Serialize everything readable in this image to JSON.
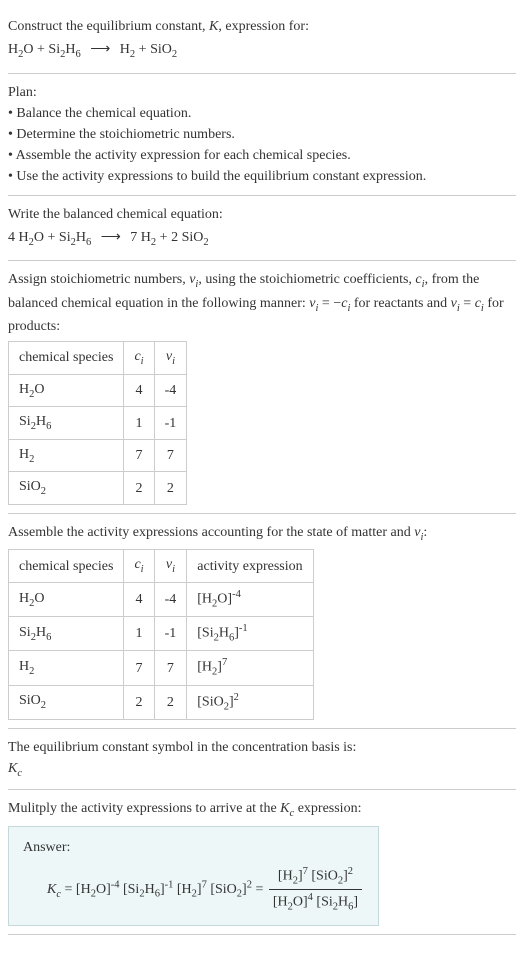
{
  "prompt": {
    "line1_pre": "Construct the equilibrium constant, ",
    "line1_K": "K",
    "line1_post": ", expression for:",
    "eq_lhs_h2o": "H",
    "eq_lhs_plus": " + ",
    "eq_lhs_sih": "Si",
    "eq_lhs_sih_sub1": "2",
    "eq_lhs_sih_h": "H",
    "eq_lhs_sih_sub2": "6",
    "eq_arrow": "⟶",
    "eq_rhs_h2": "H",
    "eq_rhs_h2_sub": "2",
    "eq_rhs_plus": " + ",
    "eq_rhs_sio": "SiO",
    "eq_rhs_sio_sub": "2",
    "h2o_sub": "2"
  },
  "plan": {
    "title": "Plan:",
    "b1": "• Balance the chemical equation.",
    "b2": "• Determine the stoichiometric numbers.",
    "b3": "• Assemble the activity expression for each chemical species.",
    "b4": "• Use the activity expressions to build the equilibrium constant expression."
  },
  "balanced": {
    "title": "Write the balanced chemical equation:",
    "c_h2o": "4 H",
    "h2o_sub": "2",
    "h2o_o": "O",
    "plus1": " + ",
    "sih": "Si",
    "sih_sub1": "2",
    "sih_h": "H",
    "sih_sub2": "6",
    "arrow": "⟶",
    "c_h2": "7 H",
    "h2_sub": "2",
    "plus2": " + ",
    "c_sio": "2 SiO",
    "sio_sub": "2"
  },
  "stoich": {
    "intro1": "Assign stoichiometric numbers, ",
    "nu": "ν",
    "i": "i",
    "intro2": ", using the stoichiometric coefficients, ",
    "c": "c",
    "intro3": ", from the balanced chemical equation in the following manner: ",
    "rel_react_lhs": "ν",
    "rel_react_eq": " = −",
    "rel_react_rhs": "c",
    "for_react": " for reactants and ",
    "rel_prod_lhs": "ν",
    "rel_prod_eq": " = ",
    "rel_prod_rhs": "c",
    "for_prod": " for products:",
    "th_species": "chemical species",
    "th_ci": "c",
    "th_nui": "ν",
    "rows": [
      {
        "species_a": "H",
        "sub_a": "2",
        "species_b": "O",
        "sub_b": "",
        "ci": "4",
        "nui": "-4"
      },
      {
        "species_a": "Si",
        "sub_a": "2",
        "species_b": "H",
        "sub_b": "6",
        "ci": "1",
        "nui": "-1"
      },
      {
        "species_a": "H",
        "sub_a": "2",
        "species_b": "",
        "sub_b": "",
        "ci": "7",
        "nui": "7"
      },
      {
        "species_a": "SiO",
        "sub_a": "2",
        "species_b": "",
        "sub_b": "",
        "ci": "2",
        "nui": "2"
      }
    ]
  },
  "activity": {
    "intro_pre": "Assemble the activity expressions accounting for the state of matter and ",
    "nu": "ν",
    "i": "i",
    "intro_post": ":",
    "th_species": "chemical species",
    "th_ci": "c",
    "th_nui": "ν",
    "th_act": "activity expression",
    "rows": [
      {
        "sp_a": "H",
        "sub_a": "2",
        "sp_b": "O",
        "sub_b": "",
        "ci": "4",
        "nui": "-4",
        "act_a": "[H",
        "act_sub": "2",
        "act_b": "O]",
        "exp": "-4"
      },
      {
        "sp_a": "Si",
        "sub_a": "2",
        "sp_b": "H",
        "sub_b": "6",
        "ci": "1",
        "nui": "-1",
        "act_a": "[Si",
        "act_sub": "2",
        "act_b2": "H",
        "act_sub2": "6",
        "act_b": "]",
        "exp": "-1"
      },
      {
        "sp_a": "H",
        "sub_a": "2",
        "sp_b": "",
        "sub_b": "",
        "ci": "7",
        "nui": "7",
        "act_a": "[H",
        "act_sub": "2",
        "act_b": "]",
        "exp": "7"
      },
      {
        "sp_a": "SiO",
        "sub_a": "2",
        "sp_b": "",
        "sub_b": "",
        "ci": "2",
        "nui": "2",
        "act_a": "[SiO",
        "act_sub": "2",
        "act_b": "]",
        "exp": "2"
      }
    ]
  },
  "symbol": {
    "text": "The equilibrium constant symbol in the concentration basis is:",
    "K": "K",
    "c": "c"
  },
  "multiply": {
    "pre": "Mulitply the activity expressions to arrive at the ",
    "K": "K",
    "c": "c",
    "post": " expression:"
  },
  "answer": {
    "label": "Answer:",
    "K": "K",
    "c": "c",
    "eq": " = ",
    "t1_a": "[H",
    "t1_s": "2",
    "t1_b": "O]",
    "t1_e": "-4",
    "t2_a": "[Si",
    "t2_s": "2",
    "t2_m": "H",
    "t2_s2": "6",
    "t2_b": "]",
    "t2_e": "-1",
    "t3_a": "[H",
    "t3_s": "2",
    "t3_b": "]",
    "t3_e": "7",
    "t4_a": "[SiO",
    "t4_s": "2",
    "t4_b": "]",
    "t4_e": "2",
    "frac_eq": " = ",
    "num_t1_a": "[H",
    "num_t1_s": "2",
    "num_t1_b": "]",
    "num_t1_e": "7",
    "num_t2_a": "[SiO",
    "num_t2_s": "2",
    "num_t2_b": "]",
    "num_t2_e": "2",
    "den_t1_a": "[H",
    "den_t1_s": "2",
    "den_t1_b": "O]",
    "den_t1_e": "4",
    "den_t2_a": "[Si",
    "den_t2_s": "2",
    "den_t2_m": "H",
    "den_t2_s2": "6",
    "den_t2_b": "]"
  }
}
